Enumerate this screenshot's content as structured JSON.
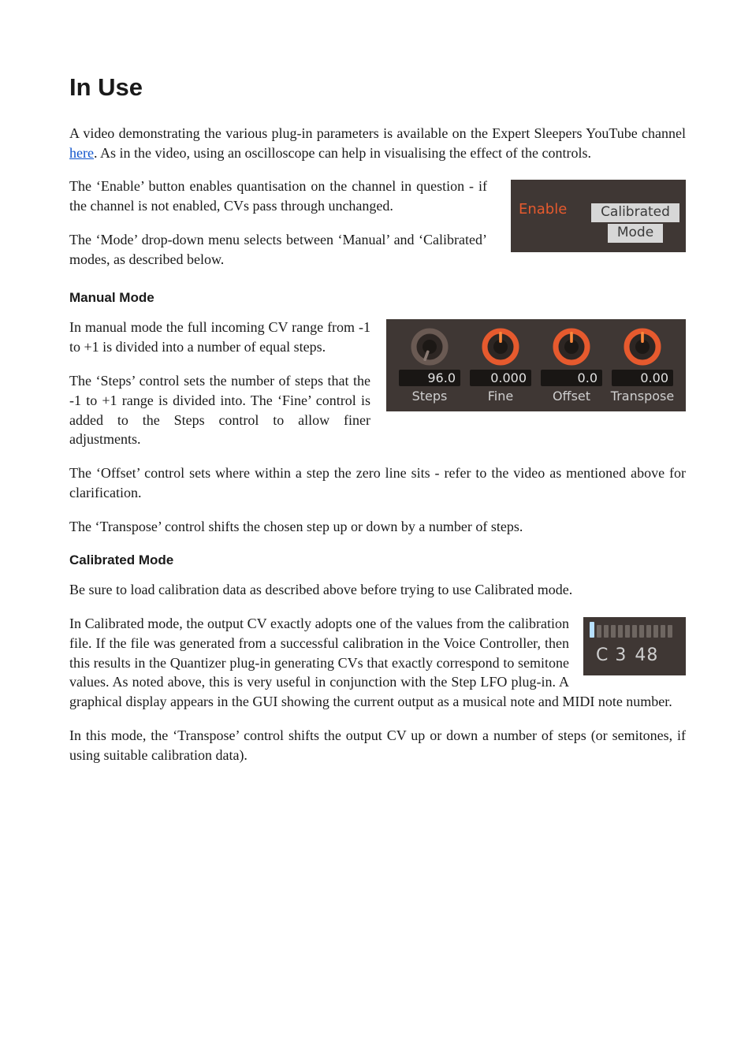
{
  "title": "In Use",
  "intro": {
    "p1_a": "A video demonstrating the various plug-in parameters is available on the Expert Sleepers YouTube channel ",
    "p1_link": "here",
    "p1_b": ". As in the video, using an oscilloscope can help in visualising the effect of the controls."
  },
  "enable_para": "The ‘Enable’ button enables quantisation on the channel in question - if the channel is not enabled, CVs pass through unchanged.",
  "mode_para": "The ‘Mode’ drop-down menu selects between ‘Manual’ and ‘Calibrated’ modes, as described below.",
  "fig1": {
    "enable_label": "Enable",
    "mode_line1": "Calibrated",
    "mode_line2": "Mode"
  },
  "manual": {
    "heading": "Manual Mode",
    "p1": "In manual mode the full incoming CV range from -1 to +1 is divided into a number of equal steps.",
    "p2": "The ‘Steps’ control sets the number of steps that the -1 to +1 range is divided into. The ‘Fine’ control is added to the Steps control to allow finer adjustments.",
    "p3": "The ‘Offset’ control sets where within a step the zero line sits - refer to the video as mentioned above for clarification.",
    "p4": "The ‘Transpose’ control shifts the chosen step up or down by a number of steps."
  },
  "fig2": {
    "knobs": [
      {
        "value": "96.0",
        "label": "Steps",
        "angle": -160
      },
      {
        "value": "0.000",
        "label": "Fine",
        "angle": 0
      },
      {
        "value": "0.0",
        "label": "Offset",
        "angle": 0
      },
      {
        "value": "0.00",
        "label": "Transpose",
        "angle": 0
      }
    ]
  },
  "calibrated": {
    "heading": "Calibrated Mode",
    "p1": "Be sure to load calibration data as described above before trying to use Calibrated mode.",
    "p2": "In Calibrated mode, the output CV exactly adopts one of the values from the calibration file. If the file was generated from a successful calibration in the Voice Controller, then this results in the Quantizer plug-in generating CVs that exactly correspond to semitone values. As noted above, this is very useful in conjunction with the Step LFO plug-in. A graphical display appears in the GUI showing the current output as a musical note and MIDI note number.",
    "p3": "In this mode, the ‘Transpose’ control shifts the output CV up or down a number of steps (or semitones, if using suitable calibration data)."
  },
  "fig3": {
    "note_name": "C 3",
    "note_number": "48"
  }
}
